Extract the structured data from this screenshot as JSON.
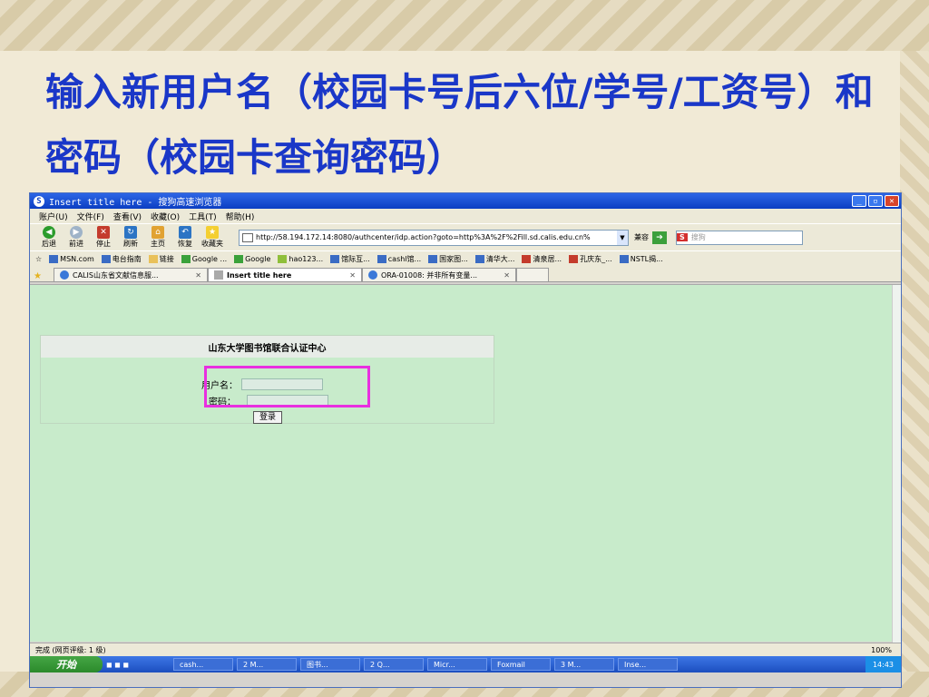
{
  "slide": {
    "title": "输入新用户名（校园卡号后六位/学号/工资号）和密码（校园卡查询密码）"
  },
  "browser": {
    "window_title": "Insert title here - 搜狗高速浏览器",
    "menu": [
      "账户(U)",
      "文件(F)",
      "查看(V)",
      "收藏(O)",
      "工具(T)",
      "帮助(H)"
    ],
    "toolbar": [
      "后退",
      "前进",
      "停止",
      "刷新",
      "主页",
      "恢复",
      "收藏夹"
    ],
    "address": "http://58.194.172.14:8080/authcenter/idp.action?goto=http%3A%2F%2Fill.sd.calis.edu.cn%",
    "compat_label": "兼容",
    "search_placeholder": "搜狗",
    "favorites": [
      "MSN.com",
      "电台指南",
      "链接",
      "Google ...",
      "Google",
      "hao123...",
      "馆际互...",
      "cashl馆...",
      "国家图...",
      "清华大...",
      "清泉居...",
      "孔庆东_...",
      "NSTL揭..."
    ],
    "tabs": [
      {
        "label": "CALIS山东省文献信息服...",
        "active": false
      },
      {
        "label": "Insert title here",
        "active": true
      },
      {
        "label": "ORA-01008: 并非所有变量...",
        "active": false
      }
    ]
  },
  "page": {
    "header": "山东大学图书馆联合认证中心",
    "username_label": "用户名：",
    "password_label": "密码：",
    "login_button": "登录"
  },
  "status": {
    "text": "完成 (网页评级: 1 级)",
    "zoom": "100%"
  },
  "taskbar": {
    "start": "开始",
    "tasks": [
      "cash...",
      "2 M...",
      "图书...",
      "2 Q...",
      "Micr...",
      "Foxmail",
      "3 M...",
      "Inse..."
    ],
    "clock": "14:43"
  },
  "colors": {
    "title_blue": "#1a37c8",
    "page_bg": "#c8ebcb",
    "highlight": "#e82fe0"
  }
}
